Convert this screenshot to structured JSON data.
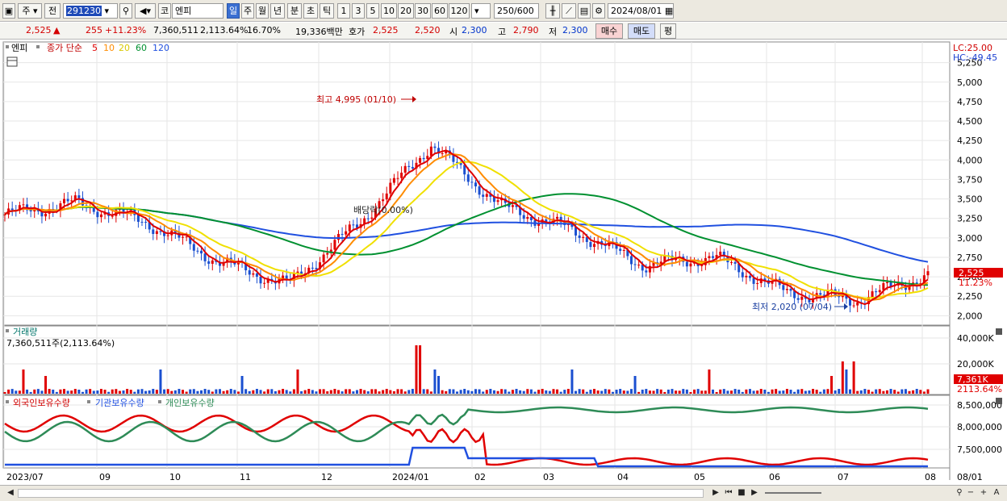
{
  "toolbar": {
    "market_type": "주",
    "prev_label": "전",
    "code": "291230",
    "market_tag": "코",
    "stock_name": "엔피",
    "periods": [
      "일",
      "주",
      "월",
      "년",
      "분",
      "초",
      "틱"
    ],
    "selected_period": "일",
    "intervals": [
      "1",
      "3",
      "5",
      "10",
      "20",
      "30",
      "60",
      "120"
    ],
    "count": "250/600",
    "date": "2024/08/01"
  },
  "quote": {
    "price": "2,525",
    "change_sign": "▲",
    "change": "255",
    "change_pct": "+11.23%",
    "volume": "7,360,511",
    "volume_ratio": "2,113.64%",
    "turnover": "16.70%",
    "amount": "19,336백만",
    "hoga_label": "호가",
    "ask": "2,525",
    "bid": "2,520",
    "open_label": "시",
    "open": "2,300",
    "high_label": "고",
    "high": "2,790",
    "low_label": "저",
    "low": "2,300",
    "buy_label": "매수",
    "sell_label": "매도",
    "avg_label": "평"
  },
  "colors": {
    "up": "#e00000",
    "down": "#1a4fd0",
    "ma5": "#e00000",
    "ma10": "#ff8c00",
    "ma20": "#f0e000",
    "ma60": "#009030",
    "ma120": "#2050e0",
    "foreign": "#e00000",
    "institution": "#2050e0",
    "individual": "#2e8b57"
  },
  "chart_data": [
    {
      "type": "candlestick",
      "legend": {
        "name": "엔피",
        "price_label": "종가 단순",
        "ma_periods": [
          "5",
          "10",
          "20",
          "60",
          "120"
        ]
      },
      "y_ticks": [
        "5,250",
        "5,000",
        "4,750",
        "4,500",
        "4,250",
        "4,000",
        "3,750",
        "3,500",
        "3,250",
        "3,000",
        "2,750",
        "2,500",
        "2,250",
        "2,000"
      ],
      "ylim": [
        1900,
        5350
      ],
      "lc_label": "LC:25.00",
      "hc_label": "HC:-49.45",
      "current_price_label": "2,525",
      "current_change_label": "11.23%",
      "annotations": {
        "high": "최고 4,995 (01/10)",
        "low": "최저 2,020 (07/04)",
        "dividend": "배당락(0.00%)"
      },
      "x_labels": [
        "2023/07",
        "09",
        "10",
        "11",
        "12",
        "2024/01",
        "02",
        "03",
        "04",
        "05",
        "06",
        "07",
        "08"
      ],
      "x_label_right": "08/01",
      "series_close": [
        {
          "x": "2023/07",
          "close": 3300
        },
        {
          "x": "2023/08",
          "close": 3450
        },
        {
          "x": "2023/09",
          "close": 3200
        },
        {
          "x": "2023/10",
          "close": 2700
        },
        {
          "x": "2023/11",
          "close": 2400
        },
        {
          "x": "2023/12",
          "close": 3200
        },
        {
          "x": "2024/01",
          "close": 4200
        },
        {
          "x": "2024/02",
          "close": 3400
        },
        {
          "x": "2024/03",
          "close": 3100
        },
        {
          "x": "2024/04",
          "close": 2650
        },
        {
          "x": "2024/05",
          "close": 2750
        },
        {
          "x": "2024/06",
          "close": 2300
        },
        {
          "x": "2024/07",
          "close": 2200
        },
        {
          "x": "2024/08",
          "close": 2525
        }
      ],
      "ma120_end": 2780,
      "ma60_end": 2480
    },
    {
      "type": "bar",
      "title": "거래량",
      "subtitle": "7,360,511주(2,113.64%)",
      "y_ticks": [
        "40,000K",
        "20,000K"
      ],
      "current_label": "7,361K",
      "current_pct": "2113.64%"
    },
    {
      "type": "line",
      "legend": [
        "외국인보유수량",
        "기관보유수량",
        "개인보유수량"
      ],
      "y_ticks": [
        "8,500,000",
        "8,000,000",
        "7,500,000"
      ]
    }
  ],
  "footer": {
    "icons": [
      "scroll-left-icon",
      "prev-icon",
      "play-back-icon",
      "stop-icon",
      "play-icon",
      "zoom-icon",
      "plus-icon",
      "text-a-icon"
    ]
  }
}
